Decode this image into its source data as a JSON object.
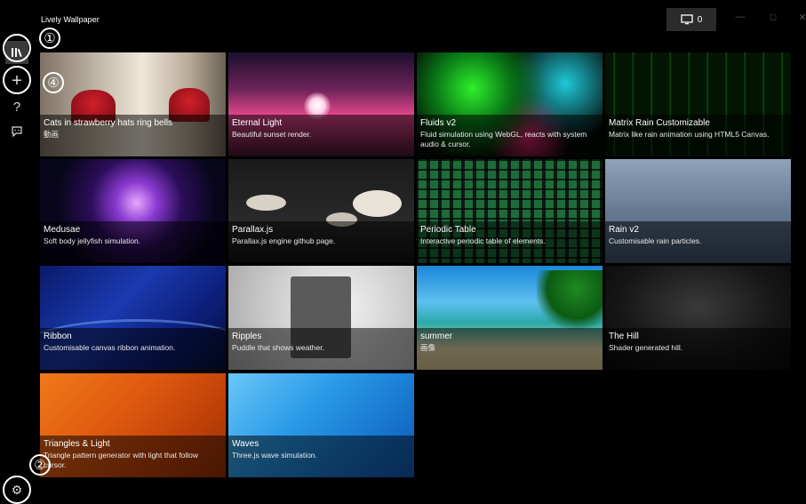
{
  "app": {
    "title": "Lively Wallpaper"
  },
  "titlebar": {
    "monitor_label": "0",
    "minimize": "—",
    "maximize": "☐",
    "close": "✕"
  },
  "sidebar": {
    "library_icon": "library-icon",
    "add_icon": "+",
    "help_icon": "?",
    "feedback_icon": "feedback-icon",
    "settings_icon": "⚙"
  },
  "callouts": {
    "c1": "①",
    "c2": "②",
    "c4": "④"
  },
  "tiles": [
    {
      "title": "Cats in strawberry hats ring bells",
      "desc": "動画"
    },
    {
      "title": "Eternal Light",
      "desc": "Beautiful sunset render."
    },
    {
      "title": "Fluids v2",
      "desc": "Fluid simulation using WebGL, reacts with system audio & cursor."
    },
    {
      "title": "Matrix Rain Customizable",
      "desc": "Matrix like rain animation using HTML5 Canvas."
    },
    {
      "title": "Medusae",
      "desc": "Soft body jellyfish simulation."
    },
    {
      "title": "Parallax.js",
      "desc": "Parallax.js engine github page."
    },
    {
      "title": "Periodic Table",
      "desc": "Interactive periodic table of elements."
    },
    {
      "title": "Rain v2",
      "desc": "Customisable rain particles."
    },
    {
      "title": "Ribbon",
      "desc": "Customisable canvas ribbon animation."
    },
    {
      "title": "Ripples",
      "desc": "Puddle that shows weather."
    },
    {
      "title": "summer",
      "desc": "画像"
    },
    {
      "title": "The Hill",
      "desc": "Shader generated hill."
    },
    {
      "title": "Triangles & Light",
      "desc": "Triangle pattern generator with light that follow cursor."
    },
    {
      "title": "Waves",
      "desc": "Three.js wave simulation."
    }
  ]
}
